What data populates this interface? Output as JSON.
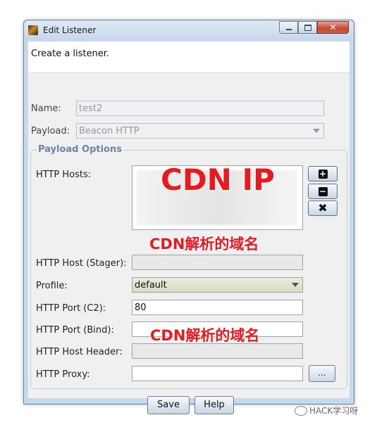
{
  "window": {
    "title": "Edit Listener"
  },
  "description": "Create a listener.",
  "form": {
    "name_label": "Name:",
    "name_value": "test2",
    "payload_label": "Payload:",
    "payload_value": "Beacon HTTP",
    "group_title": "Payload Options",
    "hosts_label": "HTTP Hosts:",
    "host_stager_label": "HTTP Host (Stager):",
    "profile_label": "Profile:",
    "profile_value": "default",
    "port_c2_label": "HTTP Port (C2):",
    "port_c2_value": "80",
    "port_bind_label": "HTTP Port (Bind):",
    "port_bind_value": "",
    "host_header_label": "HTTP Host Header:",
    "proxy_label": "HTTP Proxy:",
    "proxy_value": "",
    "proxy_button": "..."
  },
  "buttons": {
    "save": "Save",
    "help": "Help"
  },
  "annotations": {
    "cdn_ip": "CDN IP",
    "cdn_domain_stager": "CDN解析的域名",
    "cdn_domain_header": "CDN解析的域名"
  },
  "watermark": "HACK学习呀",
  "icons": [
    "app-icon",
    "minimize-icon",
    "maximize-icon",
    "close-icon",
    "plus-icon",
    "minus-icon",
    "remove-x-icon",
    "chevron-down-icon"
  ],
  "colors": {
    "annotation_red": "#e8191f",
    "group_title": "#6a84a8",
    "close_button": "#c7452e"
  }
}
